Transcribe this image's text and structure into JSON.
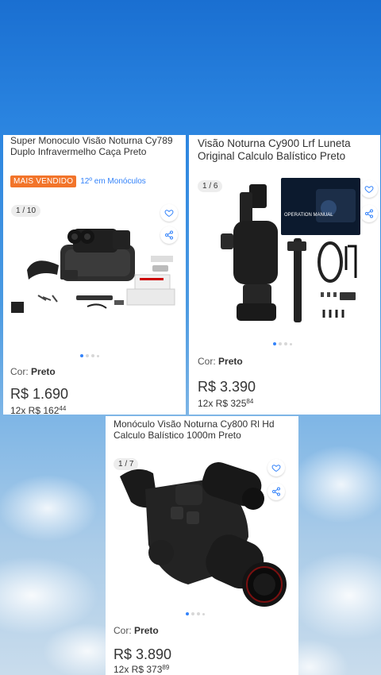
{
  "products": [
    {
      "title": "Super Monoculo Visão Noturna Cy789 Duplo Infravermelho Caça Preto",
      "badge": "MAIS VENDIDO",
      "rank": "12º em Monóculos",
      "image_counter": "1 / 10",
      "color_label": "Cor:",
      "color_value": "Preto",
      "price": "R$ 1.690",
      "installments_prefix": "12x R$ 162",
      "installments_cents": "44"
    },
    {
      "title": "Visão Noturna Cy900 Lrf Luneta Original Calculo Balístico Preto",
      "image_counter": "1 / 6",
      "manual_text": "OPERATION MANUAL",
      "color_label": "Cor:",
      "color_value": "Preto",
      "price": "R$ 3.390",
      "installments_prefix": "12x R$ 325",
      "installments_cents": "84"
    },
    {
      "title": "Monóculo Visão Noturna Cy800 Rl Hd Calculo Balístico 1000m Preto",
      "image_counter": "1 / 7",
      "color_label": "Cor:",
      "color_value": "Preto",
      "price": "R$ 3.890",
      "installments_prefix": "12x R$ 373",
      "installments_cents": "89"
    }
  ],
  "icons": [
    "heart-icon",
    "share-icon"
  ],
  "colors": {
    "accent": "#3483fa",
    "badge": "#f2742a",
    "sky_top": "#1a6fd1"
  }
}
